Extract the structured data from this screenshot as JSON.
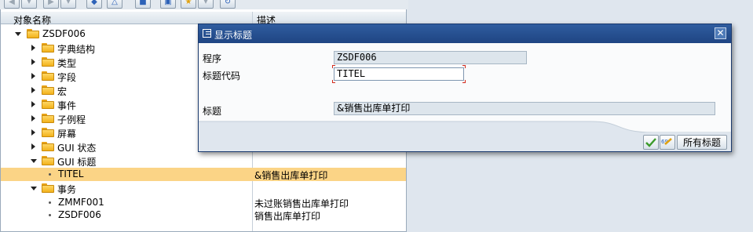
{
  "toolbar": {
    "buttons": [
      "back-icon",
      "forward-icon",
      "where-used-icon",
      "display-icon",
      "hierarchy-icon",
      "display-object-list-icon",
      "favorites-icon",
      "refresh-icon"
    ]
  },
  "tree": {
    "header": {
      "col_name": "对象名称",
      "col_desc": "描述"
    },
    "root": "ZSDF006",
    "nodes": [
      {
        "label": "字典结构"
      },
      {
        "label": "类型"
      },
      {
        "label": "字段"
      },
      {
        "label": "宏"
      },
      {
        "label": "事件"
      },
      {
        "label": "子例程"
      },
      {
        "label": "屏幕"
      },
      {
        "label": "GUI 状态"
      },
      {
        "label": "GUI 标题"
      }
    ],
    "gui_title_child": {
      "label": "TITEL",
      "desc": "&销售出库单打印"
    },
    "transactions": {
      "label": "事务",
      "items": [
        {
          "label": "ZMMF001",
          "desc": "未过账销售出库单打印"
        },
        {
          "label": "ZSDF006",
          "desc": "销售出库单打印"
        }
      ]
    },
    "selection_color": "#fbd486"
  },
  "dialog": {
    "title": "显示标题",
    "fields": {
      "program_label": "程序",
      "program_value": "ZSDF006",
      "title_code_label": "标题代码",
      "title_code_value": "TITEL",
      "title_label": "标题",
      "title_value": "&销售出库单打印"
    },
    "buttons": {
      "confirm": "continue-check-icon",
      "where_used": "where-used-icon",
      "all_titles": "所有标题"
    },
    "title_bar_color": "#24508f"
  }
}
